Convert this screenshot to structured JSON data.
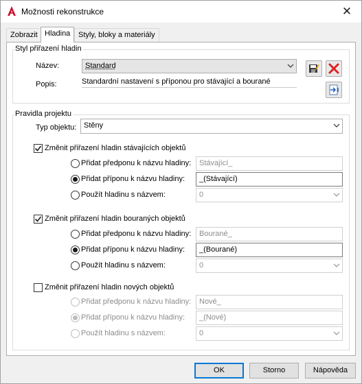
{
  "window": {
    "title": "Možnosti rekonstrukce",
    "close_glyph": "✕"
  },
  "tabs": [
    {
      "label": "Zobrazit",
      "active": false
    },
    {
      "label": "Hladina",
      "active": true
    },
    {
      "label": "Styly, bloky a materiály",
      "active": false
    }
  ],
  "layer_style": {
    "legend": "Styl přiřazení hladin",
    "name_label": "Název:",
    "name_value": "Standard",
    "description_label": "Popis:",
    "description_value": "Standardní nastavení s příponou pro stávající a bourané"
  },
  "project_rules": {
    "legend": "Pravidla projektu",
    "object_type_label": "Typ objektu:",
    "object_type_value": "Stěny"
  },
  "sections": [
    {
      "label": "Změnit přiřazení hladin stávajících objektů",
      "checked": true,
      "enabled": true,
      "prefix_label": "Přidat předponu k názvu hladiny:",
      "prefix_value": "Stávající_",
      "suffix_label": "Přidat příponu k názvu hladiny:",
      "suffix_value": "_(Stávající)",
      "use_layer_label": "Použít hladinu s názvem:",
      "use_layer_value": "0",
      "selected_option": "suffix"
    },
    {
      "label": "Změnit přiřazení hladin bouraných objektů",
      "checked": true,
      "enabled": true,
      "prefix_label": "Přidat předponu k názvu hladiny:",
      "prefix_value": "Bourané_",
      "suffix_label": "Přidat příponu k názvu hladiny:",
      "suffix_value": "_(Bourané)",
      "use_layer_label": "Použít hladinu s názvem:",
      "use_layer_value": "0",
      "selected_option": "suffix"
    },
    {
      "label": "Změnit přiřazení hladin nových objektů",
      "checked": false,
      "enabled": false,
      "prefix_label": "Přidat předponu k názvu hladiny:",
      "prefix_value": "Nové_",
      "suffix_label": "Přidat příponu k názvu hladiny:",
      "suffix_value": "_(Nové)",
      "use_layer_label": "Použít hladinu s názvem:",
      "use_layer_value": "0",
      "selected_option": "suffix"
    }
  ],
  "buttons": {
    "ok": "OK",
    "cancel": "Storno",
    "help": "Nápověda"
  },
  "icons": [
    "autocad-logo-icon",
    "close-icon",
    "save-edit-icon",
    "delete-icon",
    "import-export-icon",
    "chevron-down-icon",
    "checkmark-icon"
  ],
  "colors": {
    "accent": "#0078d7",
    "delete_red": "#e02020",
    "logo_red": "#c8102e"
  }
}
